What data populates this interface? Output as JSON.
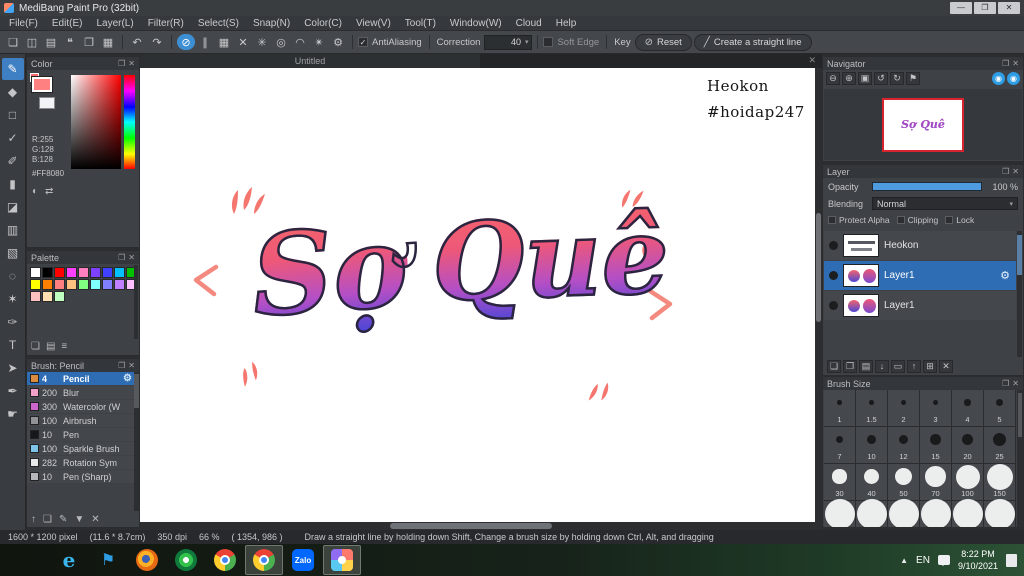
{
  "colors": {
    "accent_blue": "#3d8fd4",
    "selection_blue": "#2e6cb3",
    "foreground_color": "#FF8080",
    "decor_salmon": "#f4766f",
    "art_gradient_top": "#f4646c",
    "art_gradient_bottom": "#4b46d6",
    "navigator_view_border": "#d8242f"
  },
  "window": {
    "title": "MediBang Paint Pro (32bit)",
    "controls": [
      {
        "name": "minimize-button",
        "glyph": "—"
      },
      {
        "name": "maximize-button",
        "glyph": "❐"
      },
      {
        "name": "close-button",
        "glyph": "✕"
      }
    ]
  },
  "menu_bar": {
    "items": [
      "File(F)",
      "Edit(E)",
      "Layer(L)",
      "Filter(R)",
      "Select(S)",
      "Snap(N)",
      "Color(C)",
      "View(V)",
      "Tool(T)",
      "Window(W)",
      "Cloud",
      "Help"
    ]
  },
  "toolbar": {
    "file_icons": [
      {
        "name": "new-file-icon",
        "glyph": "❏"
      },
      {
        "name": "save-icon",
        "glyph": "◫"
      },
      {
        "name": "export-icon",
        "glyph": "▤"
      },
      {
        "name": "comment-icon",
        "glyph": "❝"
      },
      {
        "name": "copy-icon",
        "glyph": "❐"
      },
      {
        "name": "grid-icon",
        "glyph": "▦"
      }
    ],
    "undo_icon": {
      "glyph": "↶"
    },
    "redo_icon": {
      "glyph": "↷"
    },
    "snap_icons": [
      {
        "name": "snap-off-icon",
        "glyph": "⊘",
        "active": true
      },
      {
        "name": "snap-parallel-icon",
        "glyph": "∥"
      },
      {
        "name": "snap-grid-icon",
        "glyph": "▦"
      },
      {
        "name": "snap-cross-icon",
        "glyph": "✕"
      },
      {
        "name": "snap-vanishing-point-icon",
        "glyph": "✳"
      },
      {
        "name": "snap-concentric-icon",
        "glyph": "◎"
      },
      {
        "name": "snap-curve-icon",
        "glyph": "◠"
      },
      {
        "name": "snap-radial-icon",
        "glyph": "✴"
      },
      {
        "name": "snap-settings-icon",
        "glyph": "⚙"
      }
    ],
    "antialiasing_label": "AntiAliasing",
    "correction_label": "Correction",
    "correction_value": "40",
    "soft_edge_label": "Soft Edge",
    "key_label": "Key",
    "reset_icon": {
      "glyph": "⊘"
    },
    "reset_label": "Reset",
    "line_icon": {
      "glyph": "╱"
    },
    "straight_line_label": "Create a straight line"
  },
  "panel_header_icons": [
    {
      "name": "panel-popout-icon",
      "glyph": "❐"
    },
    {
      "name": "panel-close-icon",
      "glyph": "✕"
    }
  ],
  "tool_strip": [
    {
      "name": "brush-tool",
      "glyph": "✎",
      "active": true
    },
    {
      "name": "eraser-tool",
      "glyph": "◆"
    },
    {
      "name": "shape-tool",
      "glyph": "□"
    },
    {
      "name": "select-check-tool",
      "glyph": "✓"
    },
    {
      "name": "pencil-tool",
      "glyph": "✐"
    },
    {
      "name": "roller-tool",
      "glyph": "▮"
    },
    {
      "name": "bucket-tool",
      "glyph": "◪"
    },
    {
      "name": "gradient-tool",
      "glyph": "▥"
    },
    {
      "name": "select-tool",
      "glyph": "▧"
    },
    {
      "name": "lasso-tool",
      "glyph": "◌"
    },
    {
      "name": "magic-wand-tool",
      "glyph": "✶"
    },
    {
      "name": "select-pen-tool",
      "glyph": "✑"
    },
    {
      "name": "text-tool",
      "glyph": "T"
    },
    {
      "name": "operation-tool",
      "glyph": "➤"
    },
    {
      "name": "eyedropper-tool",
      "glyph": "✒"
    },
    {
      "name": "hand-tool",
      "glyph": "☛"
    }
  ],
  "color_panel": {
    "title": "Color",
    "r_label": "R:255",
    "g_label": "G:128",
    "b_label": "B:128",
    "hex": "#FF8080",
    "footer_icons": [
      {
        "name": "color-wheel-icon",
        "glyph": "◐"
      },
      {
        "name": "swap-colors-icon",
        "glyph": "⇄"
      }
    ]
  },
  "palette_panel": {
    "title": "Palette",
    "swatches": [
      "#ffffff",
      "#000000",
      "#ff0000",
      "#ff40ff",
      "#ff80c0",
      "#8040ff",
      "#4040ff",
      "#00c0ff",
      "#00c000",
      "#ffff00",
      "#ff8000",
      "#ff8080",
      "#ffc080",
      "#80ff80",
      "#80ffff",
      "#8080ff",
      "#c080ff",
      "#ffc0ff",
      "#ffc0c0",
      "#ffe0b0",
      "#c0ffc0"
    ],
    "footer_icons": [
      {
        "name": "add-swatch-icon",
        "glyph": "❏"
      },
      {
        "name": "swatch-menu-icon",
        "glyph": "▤"
      },
      {
        "name": "swatch-list-icon",
        "glyph": "≡"
      }
    ]
  },
  "brush_panel": {
    "title": "Brush: Pencil",
    "settings_icon": {
      "glyph": "⚙"
    },
    "brushes": [
      {
        "size": "4",
        "name": "Pencil",
        "chip": "#d98b3f",
        "selected": true
      },
      {
        "size": "200",
        "name": "Blur",
        "chip": "#f2a0c8",
        "selected": false
      },
      {
        "size": "300",
        "name": "Watercolor (W",
        "chip": "#cc66cc",
        "selected": false
      },
      {
        "size": "100",
        "name": "Airbrush",
        "chip": "#8f9296",
        "selected": false
      },
      {
        "size": "10",
        "name": "Pen",
        "chip": "#17181a",
        "selected": false
      },
      {
        "size": "100",
        "name": "Sparkle Brush",
        "chip": "#7ec3e8",
        "selected": false
      },
      {
        "size": "282",
        "name": "Rotation Sym",
        "chip": "#e8e9ea",
        "selected": false
      },
      {
        "size": "10",
        "name": "Pen (Sharp)",
        "chip": "#b5b8bb",
        "selected": false
      }
    ],
    "footer_icons": [
      {
        "name": "brush-up-icon",
        "glyph": "↑"
      },
      {
        "name": "add-brush-icon",
        "glyph": "❏"
      },
      {
        "name": "edit-brush-icon",
        "glyph": "✎"
      },
      {
        "name": "brush-menu-icon",
        "glyph": "▼"
      },
      {
        "name": "delete-brush-icon",
        "glyph": "✕"
      }
    ]
  },
  "canvas": {
    "tab_title": "Untitled",
    "tab_close_glyph": "✕",
    "artwork": {
      "word_left": "Sợ",
      "word_right": "Quê",
      "signature_line1": "Heokon",
      "signature_line2": "#hoidap247"
    }
  },
  "navigator": {
    "title": "Navigator",
    "icons": [
      {
        "name": "zoom-out-icon",
        "glyph": "⊖"
      },
      {
        "name": "zoom-in-icon",
        "glyph": "⊕"
      },
      {
        "name": "fit-window-icon",
        "glyph": "▣"
      },
      {
        "name": "rotate-left-icon",
        "glyph": "↺"
      },
      {
        "name": "rotate-right-icon",
        "glyph": "↻"
      },
      {
        "name": "reset-view-icon",
        "glyph": "⚑"
      }
    ],
    "blue_icons": [
      {
        "name": "nav-prev-icon",
        "glyph": "◉"
      },
      {
        "name": "nav-next-icon",
        "glyph": "◉"
      }
    ]
  },
  "layer_panel": {
    "title": "Layer",
    "opacity_label": "Opacity",
    "opacity_value": "100 %",
    "blending_label": "Blending",
    "blending_value": "Normal",
    "settings_icon": {
      "glyph": "⚙"
    },
    "checkboxes": [
      {
        "name": "protect-alpha-checkbox",
        "label": "Protect Alpha"
      },
      {
        "name": "clipping-checkbox",
        "label": "Clipping"
      },
      {
        "name": "lock-checkbox",
        "label": "Lock"
      }
    ],
    "layers": [
      {
        "name": "Heokon",
        "selected": false,
        "thumb": "text"
      },
      {
        "name": "Layer1",
        "selected": true,
        "thumb": "art"
      },
      {
        "name": "Layer1",
        "selected": false,
        "thumb": "art"
      }
    ],
    "footer_icons": [
      {
        "name": "add-layer-icon",
        "glyph": "❏"
      },
      {
        "name": "duplicate-layer-icon",
        "glyph": "❐"
      },
      {
        "name": "merge-layer-icon",
        "glyph": "▤"
      },
      {
        "name": "layer-down-icon",
        "glyph": "↓"
      },
      {
        "name": "folder-icon",
        "glyph": "▭"
      },
      {
        "name": "layer-up-icon",
        "glyph": "↑"
      },
      {
        "name": "combine-icon",
        "glyph": "⊞"
      },
      {
        "name": "delete-layer-icon",
        "glyph": "✕"
      }
    ]
  },
  "brush_size_panel": {
    "title": "Brush Size",
    "sizes": [
      "1",
      "1.5",
      "2",
      "3",
      "4",
      "5",
      "7",
      "10",
      "12",
      "15",
      "20",
      "25",
      "30",
      "40",
      "50",
      "70",
      "100",
      "150"
    ],
    "partial_row": [
      "",
      "",
      "",
      "",
      "",
      ""
    ]
  },
  "status_bar": {
    "dimensions": "1600 * 1200 pixel",
    "physical": "(11.6 * 8.7cm)",
    "dpi": "350 dpi",
    "zoom": "66 %",
    "coordinates": "( 1354, 986 )",
    "hint": "Draw a straight line by holding down Shift, Change a brush size by holding down Ctrl, Alt, and dragging"
  },
  "taskbar": {
    "icons": [
      {
        "name": "start-button",
        "style": "start",
        "active": false
      },
      {
        "name": "edge-icon",
        "style": "edge",
        "label": "e",
        "active": false
      },
      {
        "name": "flag-icon",
        "style": "flag",
        "label": "⚑",
        "active": false
      },
      {
        "name": "firefox-icon",
        "style": "firefox",
        "active": false
      },
      {
        "name": "browser-icon",
        "style": "browser2",
        "active": false
      },
      {
        "name": "chrome-icon",
        "style": "chrome",
        "active": false
      },
      {
        "name": "chrome-window-icon",
        "style": "chrome",
        "active": true
      },
      {
        "name": "zalo-icon",
        "style": "zalo",
        "label": "Zalo",
        "active": false
      },
      {
        "name": "medibang-icon",
        "style": "medibang",
        "active": true
      }
    ],
    "tray": {
      "up_glyph": "▲",
      "language": "EN",
      "time": "8:22 PM",
      "date": "9/10/2021"
    }
  }
}
